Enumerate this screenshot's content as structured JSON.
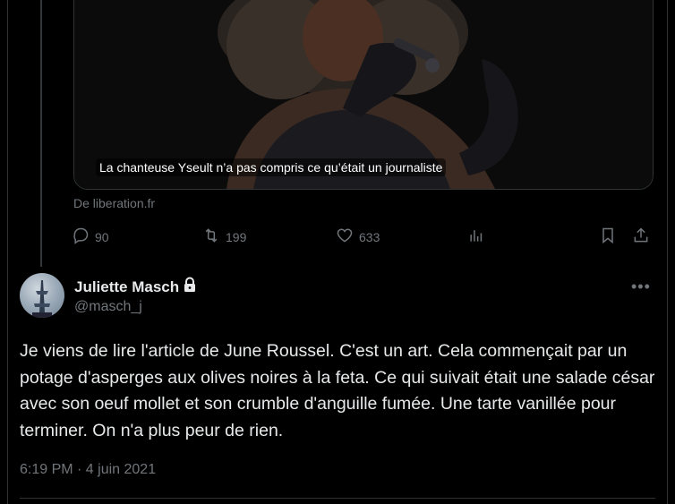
{
  "card": {
    "caption": "La chanteuse Yseult n’a pas compris ce qu’était un journaliste",
    "source": "De liberation.fr"
  },
  "actions": {
    "reply_count": "90",
    "retweet_count": "199",
    "like_count": "633"
  },
  "icons": {
    "reply": "reply-icon",
    "retweet": "retweet-icon",
    "like": "heart-icon",
    "views": "views-icon",
    "bookmark": "bookmark-icon",
    "share": "share-icon",
    "lock": "lock-icon",
    "more": "more-icon"
  },
  "tweet": {
    "display_name": "Juliette Masch",
    "handle": "@masch_j",
    "more": "•••",
    "text": "Je viens de lire l'article de June Roussel. C'est un art. Cela commençait par un potage d'asperges aux olives noires à la feta. Ce qui suivait était une salade césar avec son oeuf mollet et son crumble d'anguille fumée. Une tarte vanillée pour terminer. On n'a plus peur de rien.",
    "timestamp": "6:19 PM · 4 juin 2021"
  },
  "colors": {
    "background": "#000000",
    "text_primary": "#e7e9ea",
    "text_secondary": "#71767b",
    "border": "#2f3336"
  }
}
